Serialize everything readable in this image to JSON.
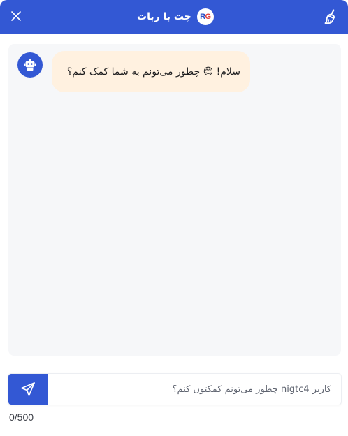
{
  "header": {
    "title": "چت با ربات",
    "logo_text_r": "R",
    "logo_text_g": "G",
    "accent_color": "#3358d4"
  },
  "icons": {
    "close": "close-icon",
    "clear": "broom-icon",
    "bot": "robot-icon",
    "send": "send-icon"
  },
  "messages": [
    {
      "sender": "bot",
      "text": "سلام! 😊 چطور می‌تونم به شما کمک کنم؟"
    }
  ],
  "composer": {
    "placeholder": "کاربر nigtc4 چطور می‌تونم کمکتون کنم؟",
    "value": "",
    "char_count": "0/500"
  }
}
